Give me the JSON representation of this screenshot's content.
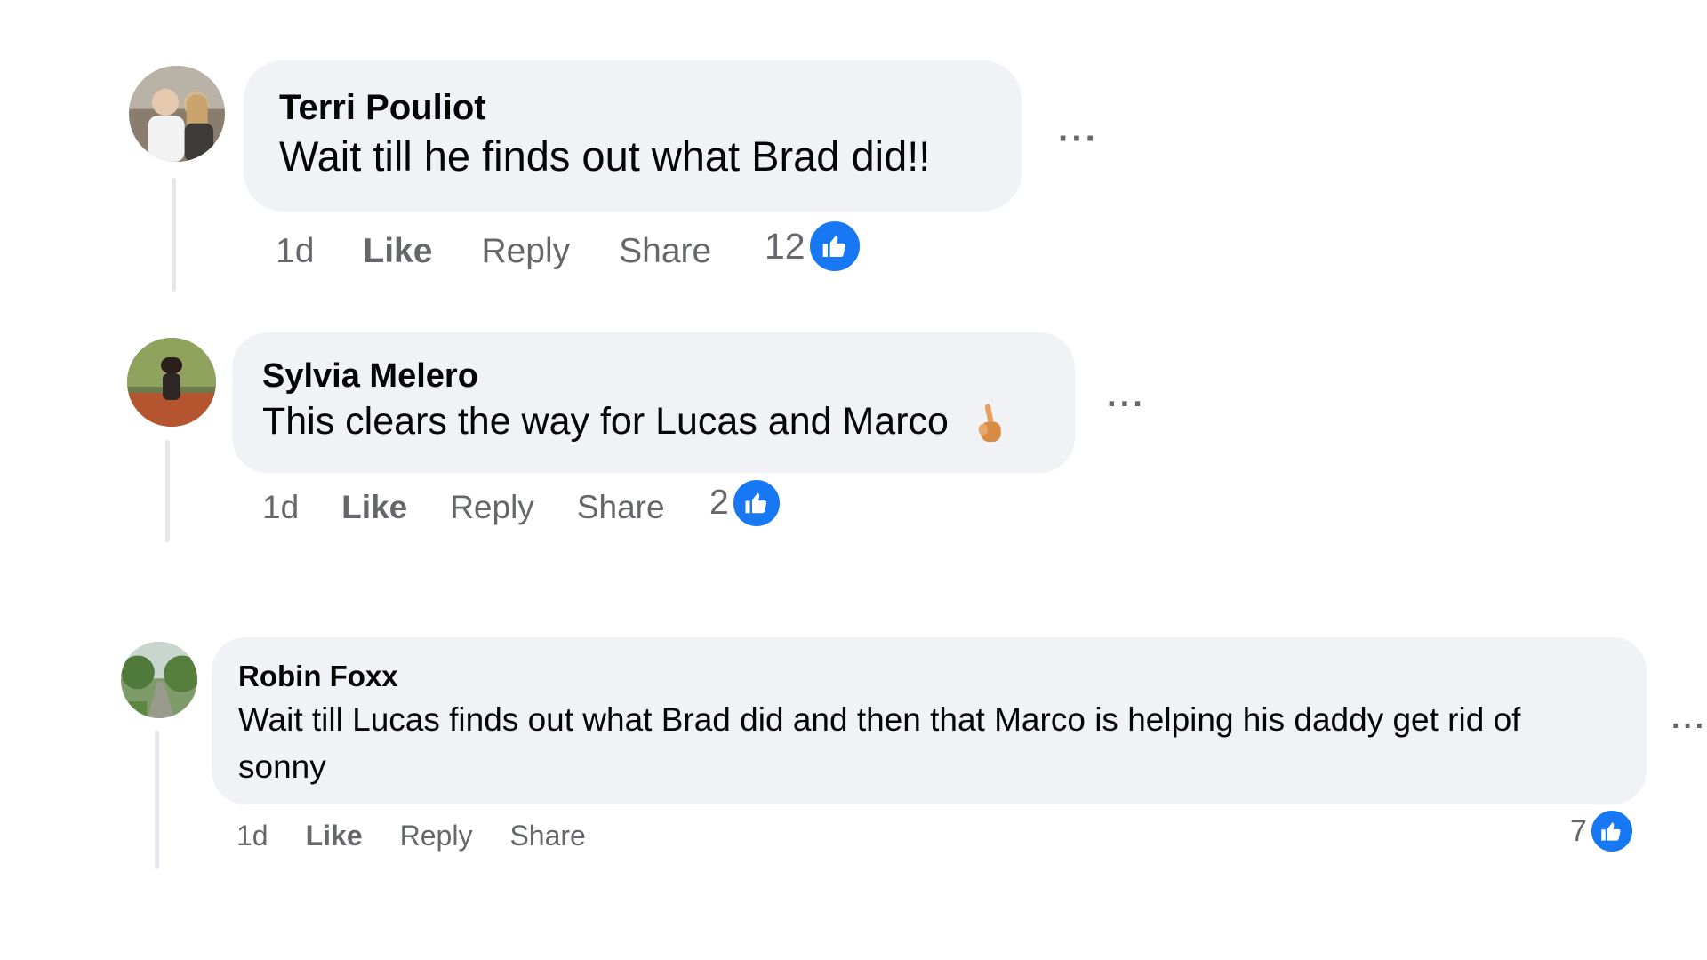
{
  "comments": [
    {
      "author": "Terri Pouliot",
      "text": "Wait till he finds out what Brad did!!",
      "time": "1d",
      "like_label": "Like",
      "reply_label": "Reply",
      "share_label": "Share",
      "reaction_count": "12",
      "more_label": "···"
    },
    {
      "author": "Sylvia Melero",
      "text": "This clears the way for Lucas and Marco",
      "time": "1d",
      "like_label": "Like",
      "reply_label": "Reply",
      "share_label": "Share",
      "reaction_count": "2",
      "more_label": "···",
      "emoji": "crossed-fingers-emoji"
    },
    {
      "author": "Robin Foxx",
      "text": "Wait till Lucas finds out what Brad did and then that Marco is helping his daddy get rid of sonny",
      "time": "1d",
      "like_label": "Like",
      "reply_label": "Reply",
      "share_label": "Share",
      "reaction_count": "7",
      "more_label": "···"
    }
  ],
  "colors": {
    "bubble": "#f0f2f5",
    "meta_text": "#65676b",
    "like_blue": "#1877f2",
    "thread_line": "#e4e6eb"
  },
  "icons": [
    "thumbs-up-icon",
    "more-options-icon"
  ]
}
